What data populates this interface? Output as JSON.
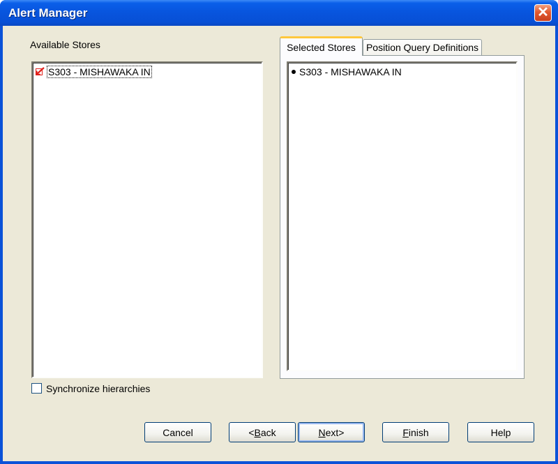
{
  "window": {
    "title": "Alert Manager",
    "close_symbol": "✕"
  },
  "available_stores": {
    "label": "Available Stores",
    "items": [
      {
        "label": "S303 - MISHAWAKA IN",
        "icon": "checked-arrow-icon",
        "focused": true
      }
    ]
  },
  "synchronize": {
    "label": "Synchronize hierarchies",
    "checked": false
  },
  "tabs": [
    {
      "label": "Selected Stores",
      "active": true
    },
    {
      "label": "Position Query Definitions",
      "active": false
    }
  ],
  "selected_stores": {
    "items": [
      {
        "label": "S303 - MISHAWAKA IN"
      }
    ]
  },
  "buttons": {
    "cancel": "Cancel",
    "back_prefix": "<",
    "back_mnemonic": "B",
    "back_rest": "ack",
    "next_mnemonic": "N",
    "next_rest": "ext>",
    "finish_mnemonic": "F",
    "finish_rest": "inish",
    "help": "Help"
  },
  "colors": {
    "titlebar": "#0854dd",
    "dialog_bg": "#ece9d8",
    "close_button": "#e2592f",
    "active_tab_accent": "#ffc83c",
    "check_mark": "#e0201a"
  }
}
